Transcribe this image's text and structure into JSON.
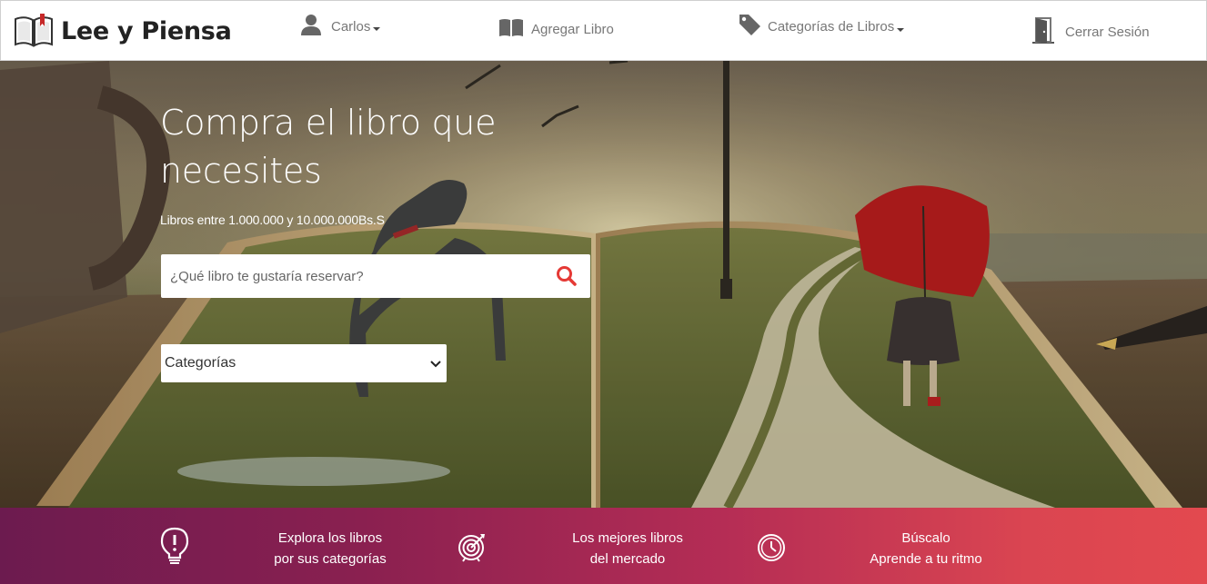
{
  "navbar": {
    "brand": "Lee y Piensa",
    "user_label": "Carlos",
    "add_book_label": "Agregar Libro",
    "categories_label": "Categorías de Libros",
    "logout_label": "Cerrar Sesión"
  },
  "hero": {
    "title": "Compra el libro que necesites",
    "subtitle": "Libros entre 1.000.000 y 10.000.000Bs.S",
    "search": {
      "placeholder": "¿Qué libro te gustaría reservar?",
      "value": ""
    },
    "category_select": {
      "selected": "Categorías"
    }
  },
  "features": [
    {
      "icon": "lightbulb-icon",
      "line1": "Explora los libros",
      "line2": "por sus categorías"
    },
    {
      "icon": "target-icon",
      "line1": "Los mejores libros",
      "line2": "del mercado"
    },
    {
      "icon": "clock-icon",
      "line1": "Búscalo",
      "line2": "Aprende a tu ritmo"
    }
  ],
  "colors": {
    "accent_search_icon": "#e53935",
    "feature_bar_start": "#6c1b4f",
    "feature_bar_end": "#e3494f"
  }
}
